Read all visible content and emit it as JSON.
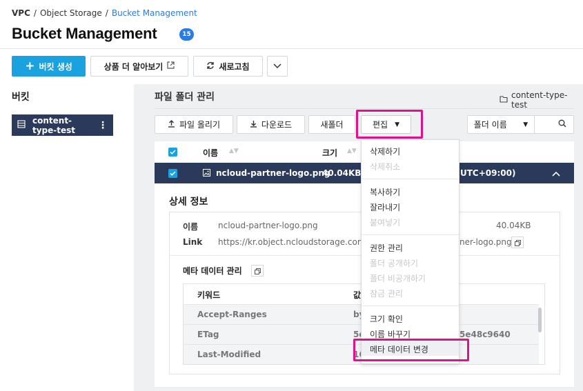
{
  "breadcrumb": {
    "items": [
      "VPC",
      "/",
      "Object Storage",
      "/",
      "Bucket Management"
    ]
  },
  "page": {
    "title": "Bucket Management",
    "badge": "15"
  },
  "toolbar_top": {
    "create_bucket": "버킷 생성",
    "learn_more": "상품 더 알아보기",
    "refresh": "새로고침"
  },
  "sidebar": {
    "title": "버킷",
    "bucket_name": "content-type-test"
  },
  "main": {
    "section_title": "파일 폴더 관리",
    "folder_path": "content-type-test",
    "toolbar": {
      "upload": "파일 올리기",
      "download": "다운로드",
      "new_folder": "새폴더",
      "edit": "편집",
      "folder_name": "폴더 이름"
    }
  },
  "table": {
    "headers": {
      "name": "이름",
      "size": "크기"
    },
    "selected_row": {
      "name": "ncloud-partner-logo.png",
      "size": "40.04KB",
      "date_tail": "UTC+09:00)"
    }
  },
  "details": {
    "title": "상세 정보",
    "name_label": "이름",
    "name_value": "ncloud-partner-logo.png",
    "size_value": "40.04KB",
    "link_label": "Link",
    "link_value_left": "https://kr.object.ncloudstorage.com/co",
    "link_value_right": "ner-logo.png",
    "meta_title": "메타 데이터 관리",
    "meta_headers": {
      "keyword": "키워드",
      "value": "값"
    },
    "meta_rows": [
      {
        "key": "Accept-Ranges",
        "value_left": "by",
        "value_right": ""
      },
      {
        "key": "ETag",
        "value_left": "5c",
        "value_right": "5e48c9640"
      },
      {
        "key": "Last-Modified",
        "value_left": "16",
        "value_right": ""
      }
    ]
  },
  "edit_menu": {
    "groups": [
      [
        {
          "label": "삭제하기",
          "enabled": true
        },
        {
          "label": "삭제취소",
          "enabled": false
        }
      ],
      [
        {
          "label": "복사하기",
          "enabled": true
        },
        {
          "label": "잘라내기",
          "enabled": true
        },
        {
          "label": "붙여넣기",
          "enabled": false
        }
      ],
      [
        {
          "label": "권한 관리",
          "enabled": true
        },
        {
          "label": "폴더 공개하기",
          "enabled": false
        },
        {
          "label": "폴더 비공개하기",
          "enabled": false
        },
        {
          "label": "잠금 관리",
          "enabled": false
        }
      ],
      [
        {
          "label": "크기 확인",
          "enabled": true
        },
        {
          "label": "이름 바꾸기",
          "enabled": true
        },
        {
          "label": "메타 데이터 변경",
          "enabled": true
        }
      ]
    ]
  },
  "colors": {
    "accent": "#1aa2e0",
    "nav_dark": "#2b3a5b",
    "highlight": "#e0118a",
    "link_blue": "#2c7be5"
  }
}
